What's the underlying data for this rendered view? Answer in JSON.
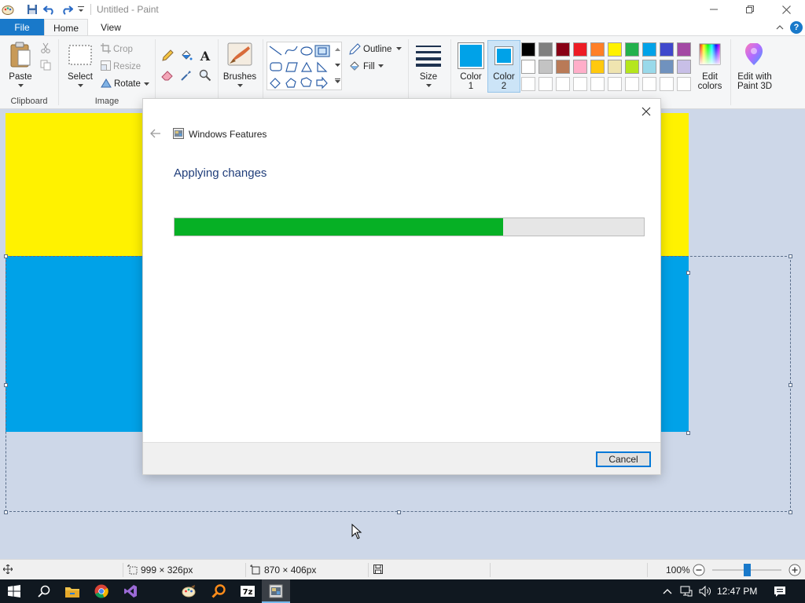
{
  "window": {
    "title": "Untitled - Paint"
  },
  "tabs": {
    "file": "File",
    "home": "Home",
    "view": "View"
  },
  "ribbon": {
    "clipboard": {
      "paste": "Paste",
      "group": "Clipboard"
    },
    "image": {
      "select": "Select",
      "crop": "Crop",
      "resize": "Resize",
      "rotate": "Rotate",
      "group": "Image"
    },
    "brushes": "Brushes",
    "shapes": {
      "outline": "Outline",
      "fill": "Fill"
    },
    "size": "Size",
    "color1": {
      "line1": "Color",
      "line2": "1",
      "swatch": "#00a2e8"
    },
    "color2": {
      "line1": "Color",
      "line2": "2",
      "swatch": "#00a2e8"
    },
    "edit_colors": {
      "line1": "Edit",
      "line2": "colors"
    },
    "paint3d": {
      "line1": "Edit with",
      "line2": "Paint 3D"
    },
    "palette_row1": [
      "#000000",
      "#7f7f7f",
      "#880015",
      "#ed1c24",
      "#ff7f27",
      "#fff200",
      "#22b14c",
      "#00a2e8",
      "#3f48cc",
      "#a349a4"
    ],
    "palette_row2": [
      "#ffffff",
      "#c3c3c3",
      "#b97a57",
      "#ffaec9",
      "#ffc90e",
      "#efe4b0",
      "#b5e61d",
      "#99d9ea",
      "#7092be",
      "#c8bfe7"
    ]
  },
  "canvas": {
    "top_color": "#fff200",
    "bottom_color": "#00a2e8"
  },
  "dialog": {
    "title": "Windows Features",
    "heading": "Applying changes",
    "progress_percent": 70,
    "cancel": "Cancel"
  },
  "statusbar": {
    "selection_size": "999 × 326px",
    "image_size": "870 × 406px",
    "zoom": "100%"
  },
  "taskbar": {
    "time": "12:47 PM"
  }
}
